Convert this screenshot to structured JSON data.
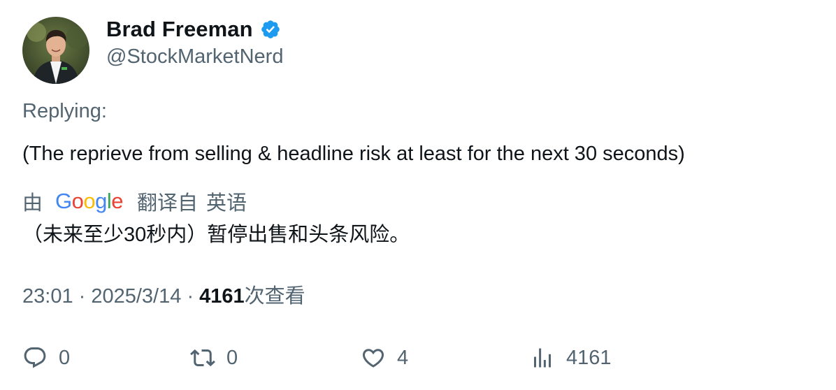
{
  "author": {
    "display_name": "Brad Freeman",
    "handle": "@StockMarketNerd",
    "verified": true,
    "avatar_icon": "profile-photo"
  },
  "tweet": {
    "replying_label": "Replying:",
    "text": "(The reprieve from selling & headline risk at least for the next 30 seconds)"
  },
  "translation": {
    "by_label": "由",
    "provider": "Google",
    "translated_from_label": "翻译自",
    "language": "英语",
    "text": "（未来至少30秒内）暂停出售和头条风险。"
  },
  "meta": {
    "time": "23:01",
    "separator": "·",
    "date": "2025/3/14",
    "views_count": "4161",
    "views_label": "次查看"
  },
  "actions": {
    "reply_count": "0",
    "retweet_count": "0",
    "like_count": "4",
    "views_count": "4161"
  },
  "colors": {
    "primary_text": "#0f1419",
    "secondary_text": "#536471",
    "verified_blue": "#1d9bf0"
  }
}
